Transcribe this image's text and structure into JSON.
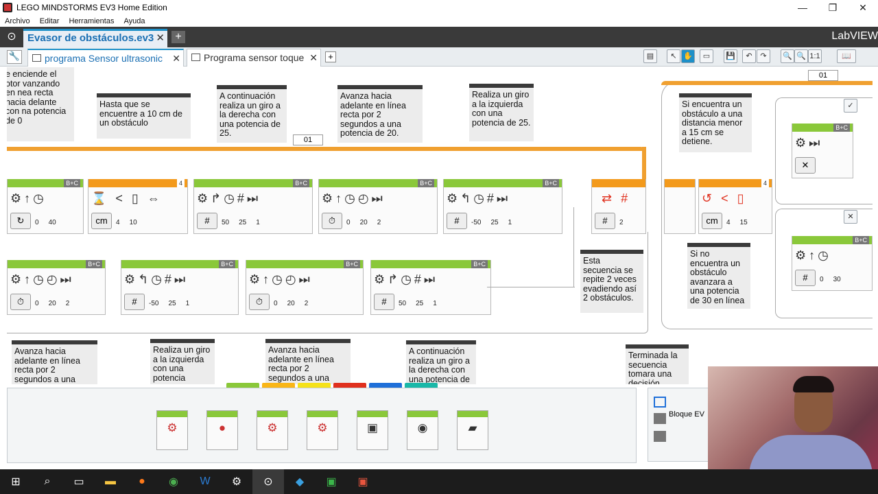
{
  "window": {
    "title": "LEGO MINDSTORMS EV3 Home Edition",
    "minimize": "—",
    "maximize": "❐",
    "close": "✕"
  },
  "menu": [
    "Archivo",
    "Editar",
    "Herramientas",
    "Ayuda"
  ],
  "project": {
    "tab_label": "Evasor de obstáculos.ev3",
    "close": "✕",
    "add": "+",
    "brand": "LabVIEW"
  },
  "program_tabs": [
    {
      "label": "programa Sensor ultrasonic",
      "active": true
    },
    {
      "label": "Programa sensor toque",
      "active": false
    }
  ],
  "program_close": "✕",
  "program_add": "+",
  "comments": {
    "c1": "e enciende el otor vanzando en nea recta hacia delante con na potencia de 0",
    "c2": "Hasta que se encuentre a 10 cm de un obstáculo",
    "c3": "A continuación realiza un giro a la derecha con una potencia de 25.",
    "c4": "Avanza hacia adelante en línea recta  por 2 segundos a una potencia de 20.",
    "c5": "Realiza un giro a la izquierda con una potencia de 25.",
    "c6": "Si encuentra un obstáculo a una distancia menor a 15 cm se detiene.",
    "c7": "Esta secuencia se repite 2 veces evadiendo así 2 obstáculos.",
    "c8": "Si no encuentra un obstáculo avanzara a una potencia de 30 en línea",
    "c9": "Avanza hacia adelante en línea recta  por 2 segundos a una",
    "c10": "Realiza un giro a la izquierda con una potencia",
    "c11": "Avanza hacia adelante en línea recta  por 2 segundos a una",
    "c12": "A continuación realiza un giro a la derecha con una potencia de",
    "c13": "Terminada la secuencia tomara una decisión"
  },
  "loop_labels": {
    "loop1": "01",
    "loop2": "01"
  },
  "blocks_row1": [
    {
      "port": "B+C",
      "vals": [
        "0",
        "40"
      ],
      "mode": "↻"
    },
    {
      "port": "4",
      "vals": [
        "4",
        "10"
      ],
      "mode": "cm"
    },
    {
      "port": "B+C",
      "vals": [
        "50",
        "25",
        "1"
      ],
      "mode": "#"
    },
    {
      "port": "B+C",
      "vals": [
        "0",
        "20",
        "2"
      ],
      "mode": "⏱"
    },
    {
      "port": "B+C",
      "vals": [
        "-50",
        "25",
        "1"
      ],
      "mode": "#"
    }
  ],
  "loop_block": {
    "count": "2",
    "symbol": "#"
  },
  "switch_block": {
    "port": "4",
    "vals": [
      "4",
      "15"
    ],
    "mode": "cm"
  },
  "blocks_row2": [
    {
      "port": "B+C",
      "vals": [
        "0",
        "20",
        "2"
      ],
      "mode": "⏱"
    },
    {
      "port": "B+C",
      "vals": [
        "-50",
        "25",
        "1"
      ],
      "mode": "#"
    },
    {
      "port": "B+C",
      "vals": [
        "0",
        "20",
        "2"
      ],
      "mode": "⏱"
    },
    {
      "port": "B+C",
      "vals": [
        "50",
        "25",
        "1"
      ],
      "mode": "#"
    }
  ],
  "switch_true": {
    "port": "B+C",
    "mode": "✕"
  },
  "switch_false": {
    "port": "B+C",
    "vals": [
      "0",
      "30"
    ],
    "mode": "#"
  },
  "sidepanel": {
    "label": "Bloque EV"
  },
  "palette_colors": [
    "#8ac83a",
    "#f9b617",
    "#f5e21a",
    "#e0301e",
    "#1e6fd9",
    "#1ab8a8"
  ]
}
